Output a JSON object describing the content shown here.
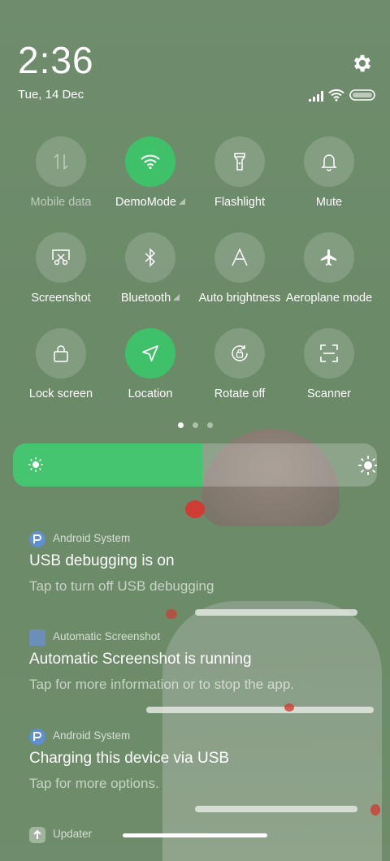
{
  "status": {
    "time": "2:36",
    "date": "Tue, 14 Dec",
    "icons": [
      "signal-icon",
      "wifi-icon",
      "battery-icon"
    ]
  },
  "quick_settings": [
    {
      "label": "Mobile data",
      "icon": "mobile-data-icon",
      "active": false,
      "disabled": true,
      "expandable": false
    },
    {
      "label": "DemoMode",
      "icon": "wifi-icon",
      "active": true,
      "disabled": false,
      "expandable": true
    },
    {
      "label": "Flashlight",
      "icon": "flashlight-icon",
      "active": false,
      "disabled": false,
      "expandable": false
    },
    {
      "label": "Mute",
      "icon": "bell-icon",
      "active": false,
      "disabled": false,
      "expandable": false
    },
    {
      "label": "Screenshot",
      "icon": "screenshot-icon",
      "active": false,
      "disabled": false,
      "expandable": false
    },
    {
      "label": "Bluetooth",
      "icon": "bluetooth-icon",
      "active": false,
      "disabled": false,
      "expandable": true
    },
    {
      "label": "Auto brightness",
      "icon": "auto-brightness-icon",
      "active": false,
      "disabled": false,
      "expandable": false
    },
    {
      "label": "Aeroplane mode",
      "icon": "airplane-icon",
      "active": false,
      "disabled": false,
      "expandable": false
    },
    {
      "label": "Lock screen",
      "icon": "lock-icon",
      "active": false,
      "disabled": false,
      "expandable": false
    },
    {
      "label": "Location",
      "icon": "location-icon",
      "active": true,
      "disabled": false,
      "expandable": false
    },
    {
      "label": "Rotate off",
      "icon": "rotate-lock-icon",
      "active": false,
      "disabled": false,
      "expandable": false
    },
    {
      "label": "Scanner",
      "icon": "scanner-icon",
      "active": false,
      "disabled": false,
      "expandable": false
    }
  ],
  "page_indicator": {
    "pages": 3,
    "current": 1
  },
  "brightness": {
    "level": 0.52
  },
  "notifications": [
    {
      "app": "Android System",
      "title": "USB debugging is on",
      "text": "Tap to turn off USB debugging",
      "icon": "android-system-icon"
    },
    {
      "app": "Automatic Screenshot",
      "title": "Automatic Screenshot is running",
      "text": "Tap for more information or to stop the app.",
      "icon": "automatic-screenshot-app-icon"
    },
    {
      "app": "Android System",
      "title": "Charging this device via USB",
      "text": "Tap for more options.",
      "icon": "android-system-icon"
    },
    {
      "app": "Updater",
      "title": "",
      "text": "",
      "icon": "updater-icon"
    }
  ],
  "colors": {
    "accent": "#3fc16a",
    "brightness_fill": "#45c56f",
    "background": "#6f8d6c"
  }
}
